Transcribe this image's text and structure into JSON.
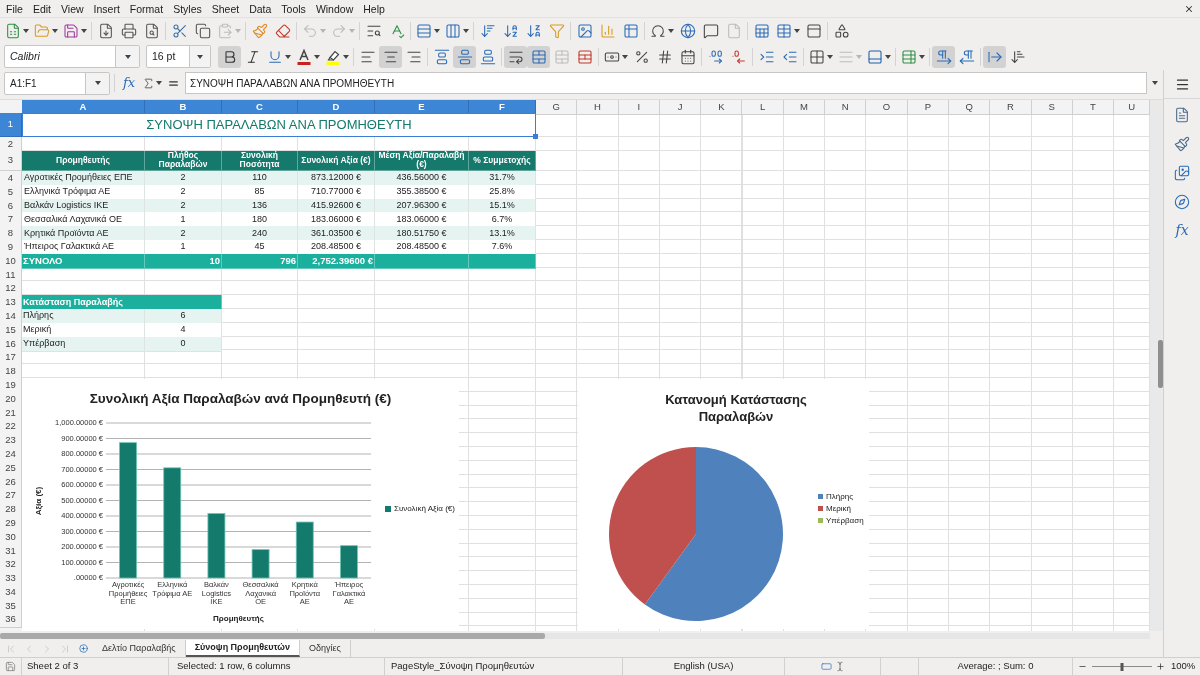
{
  "menu_bar": {
    "items": [
      "File",
      "Edit",
      "View",
      "Insert",
      "Format",
      "Styles",
      "Sheet",
      "Data",
      "Tools",
      "Window",
      "Help"
    ]
  },
  "standard_toolbar": {
    "paste_disabled": true,
    "undo_disabled": true,
    "redo_disabled": true,
    "header_footer_disabled": true
  },
  "formatting_toolbar": {
    "font_name": "Calibri",
    "font_size": "16 pt",
    "bold": true,
    "italic": false,
    "underline": false,
    "align_left": false,
    "align_center": true,
    "align_right": false,
    "align_top": false,
    "align_middle": true,
    "align_bottom": false,
    "wrap_text": true,
    "merge_center": true,
    "merge_disabled": true,
    "border_style_disabled": true,
    "left_to_right": true,
    "right_to_left": false,
    "text_horizontal": true,
    "text_vertical": false
  },
  "formula_bar": {
    "name_box": "A1:F1",
    "function_label": "fx",
    "content": "ΣΥΝΟΨΗ ΠΑΡΑΛΑΒΩΝ ΑΝΑ ΠΡΟΜΗΘΕΥΤΗ"
  },
  "sidebar": {
    "functions_label": "fx"
  },
  "sheet": {
    "columns": [
      {
        "label": "A",
        "selected": true
      },
      {
        "label": "B",
        "selected": true
      },
      {
        "label": "C",
        "selected": true
      },
      {
        "label": "D",
        "selected": true
      },
      {
        "label": "E",
        "selected": true
      },
      {
        "label": "F",
        "selected": true
      },
      {
        "label": "G",
        "selected": false
      },
      {
        "label": "H",
        "selected": false
      },
      {
        "label": "I",
        "selected": false
      },
      {
        "label": "J",
        "selected": false
      },
      {
        "label": "K",
        "selected": false
      },
      {
        "label": "L",
        "selected": false
      },
      {
        "label": "M",
        "selected": false
      },
      {
        "label": "N",
        "selected": false
      },
      {
        "label": "O",
        "selected": false
      },
      {
        "label": "P",
        "selected": false
      },
      {
        "label": "Q",
        "selected": false
      },
      {
        "label": "R",
        "selected": false
      },
      {
        "label": "S",
        "selected": false
      },
      {
        "label": "T",
        "selected": false
      },
      {
        "label": "U",
        "selected": false
      }
    ],
    "rows": [
      {
        "number": "1",
        "selected": true,
        "kind": "title",
        "cells": [
          "ΣΥΝΟΨΗ ΠΑΡΑΛΑΒΩΝ ΑΝΑ ΠΡΟΜΗΘΕΥΤΗ"
        ]
      },
      {
        "number": "2",
        "selected": false,
        "kind": "blank"
      },
      {
        "number": "3",
        "selected": false,
        "kind": "header",
        "cells": [
          "Προμηθευτής",
          "Πλήθος Παραλαβών",
          "Συνολική Ποσότητα",
          "Συνολική Αξία (€)",
          "Μέση Αξία/Παραλαβή (€)",
          "% Συμμετοχής"
        ]
      },
      {
        "number": "4",
        "selected": false,
        "kind": "data",
        "shaded": true,
        "cells": [
          "Αγροτικές Προμήθειες ΕΠΕ",
          "2",
          "110",
          "873.12000 €",
          "436.56000 €",
          "31.7%"
        ]
      },
      {
        "number": "5",
        "selected": false,
        "kind": "data",
        "shaded": false,
        "cells": [
          "Ελληνικά Τρόφιμα ΑΕ",
          "2",
          "85",
          "710.77000 €",
          "355.38500 €",
          "25.8%"
        ]
      },
      {
        "number": "6",
        "selected": false,
        "kind": "data",
        "shaded": true,
        "cells": [
          "Βαλκάν Logistics ΙΚΕ",
          "2",
          "136",
          "415.92600 €",
          "207.96300 €",
          "15.1%"
        ]
      },
      {
        "number": "7",
        "selected": false,
        "kind": "data",
        "shaded": false,
        "cells": [
          "Θεσσαλικά Λαχανικά ΟΕ",
          "1",
          "180",
          "183.06000 €",
          "183.06000 €",
          "6.7%"
        ]
      },
      {
        "number": "8",
        "selected": false,
        "kind": "data",
        "shaded": true,
        "cells": [
          "Κρητικά Προϊόντα ΑΕ",
          "2",
          "240",
          "361.03500 €",
          "180.51750 €",
          "13.1%"
        ]
      },
      {
        "number": "9",
        "selected": false,
        "kind": "data",
        "shaded": false,
        "cells": [
          "Ήπειρος Γαλακτικά ΑΕ",
          "1",
          "45",
          "208.48500 €",
          "208.48500 €",
          "7.6%"
        ]
      },
      {
        "number": "10",
        "selected": false,
        "kind": "total",
        "cells": [
          "ΣΥΝΟΛΟ",
          "10",
          "796",
          "2,752.39600 €"
        ]
      },
      {
        "number": "11",
        "selected": false,
        "kind": "blank"
      },
      {
        "number": "12",
        "selected": false,
        "kind": "blank"
      },
      {
        "number": "13",
        "selected": false,
        "kind": "section",
        "cells": [
          "Κατάσταση Παραλαβής"
        ]
      },
      {
        "number": "14",
        "selected": false,
        "kind": "status",
        "shaded": true,
        "cells": [
          "Πλήρης",
          "6"
        ]
      },
      {
        "number": "15",
        "selected": false,
        "kind": "status",
        "shaded": false,
        "cells": [
          "Μερική",
          "4"
        ]
      },
      {
        "number": "16",
        "selected": false,
        "kind": "status",
        "shaded": true,
        "cells": [
          "Υπέρβαση",
          "0"
        ]
      },
      {
        "number": "17",
        "selected": false,
        "kind": "blank"
      },
      {
        "number": "18",
        "selected": false,
        "kind": "blank"
      },
      {
        "number": "19",
        "selected": false,
        "kind": "blank"
      },
      {
        "number": "20",
        "selected": false,
        "kind": "blank"
      },
      {
        "number": "21",
        "selected": false,
        "kind": "blank"
      },
      {
        "number": "22",
        "selected": false,
        "kind": "blank"
      },
      {
        "number": "23",
        "selected": false,
        "kind": "blank"
      },
      {
        "number": "24",
        "selected": false,
        "kind": "blank"
      },
      {
        "number": "25",
        "selected": false,
        "kind": "blank"
      },
      {
        "number": "26",
        "selected": false,
        "kind": "blank"
      },
      {
        "number": "27",
        "selected": false,
        "kind": "blank"
      },
      {
        "number": "28",
        "selected": false,
        "kind": "blank"
      },
      {
        "number": "29",
        "selected": false,
        "kind": "blank"
      },
      {
        "number": "30",
        "selected": false,
        "kind": "blank"
      },
      {
        "number": "31",
        "selected": false,
        "kind": "blank"
      },
      {
        "number": "32",
        "selected": false,
        "kind": "blank"
      },
      {
        "number": "33",
        "selected": false,
        "kind": "blank"
      },
      {
        "number": "34",
        "selected": false,
        "kind": "blank"
      },
      {
        "number": "35",
        "selected": false,
        "kind": "blank"
      },
      {
        "number": "36",
        "selected": false,
        "kind": "blank"
      }
    ]
  },
  "bar_chart": {
    "chart_data": {
      "type": "bar",
      "title": "Συνολική Αξία Παραλαβών ανά Προμηθευτή (€)",
      "xlabel": "Προμηθευτής",
      "ylabel": "Αξία (€)",
      "categories": [
        "Αγροτικές Προμήθειες ΕΠΕ",
        "Ελληνικά Τρόφιμα ΑΕ",
        "Βαλκάν Logistics ΙΚΕ",
        "Θεσσαλικά Λαχανικά ΟΕ",
        "Κρητικά Προϊόντα ΑΕ",
        "Ήπειρος Γαλακτικά ΑΕ"
      ],
      "series": [
        {
          "name": "Συνολική Αξία (€)",
          "color": "#137a6c",
          "values": [
            873.12,
            710.77,
            415.926,
            183.06,
            361.035,
            208.485
          ]
        }
      ],
      "ylim": [
        0,
        1000
      ],
      "yticks": [
        {
          "value": 0,
          "label": ".00000 €"
        },
        {
          "value": 100,
          "label": "100.00000 €"
        },
        {
          "value": 200,
          "label": "200.00000 €"
        },
        {
          "value": 300,
          "label": "300.00000 €"
        },
        {
          "value": 400,
          "label": "400.00000 €"
        },
        {
          "value": 500,
          "label": "500.00000 €"
        },
        {
          "value": 600,
          "label": "600.00000 €"
        },
        {
          "value": 700,
          "label": "700.00000 €"
        },
        {
          "value": 800,
          "label": "800.00000 €"
        },
        {
          "value": 900,
          "label": "900.00000 €"
        },
        {
          "value": 1000,
          "label": "1,000.00000 €"
        }
      ],
      "grid": true,
      "legend": "right"
    }
  },
  "pie_chart": {
    "chart_data": {
      "type": "pie",
      "title": "Κατανομή Κατάστασης Παραλαβών",
      "categories": [
        "Πλήρης",
        "Μερική",
        "Υπέρβαση"
      ],
      "values": [
        60,
        40,
        0
      ],
      "colors": [
        "#4f81bd",
        "#c0504d",
        "#9bbb59"
      ],
      "legend": "right"
    }
  },
  "sheet_nav": {
    "disabled": true
  },
  "sheet_tabs": [
    {
      "label": "Δελτίο Παραλαβής",
      "selected": false
    },
    {
      "label": "Σύνοψη Προμηθευτών",
      "selected": true
    },
    {
      "label": "Οδηγίες",
      "selected": false
    }
  ],
  "status_bar": {
    "sheet": "Sheet 2 of 3",
    "selection": "Selected: 1 row, 6 columns",
    "page_style": "PageStyle_Σύνοψη Προμηθευτών",
    "language": "English (USA)",
    "summary": "Average: ; Sum: 0",
    "zoom": {
      "level": 0.5,
      "reading": "100%"
    }
  }
}
